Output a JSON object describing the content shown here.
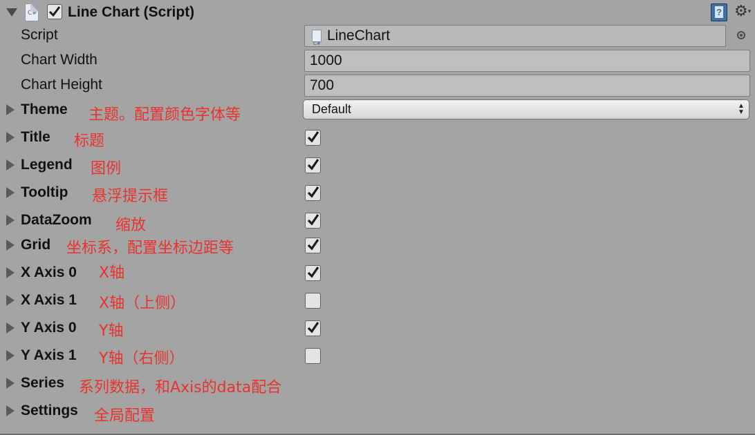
{
  "header": {
    "title": "Line Chart (Script)",
    "script_icon_text": "C#",
    "help_icon_text": "?",
    "enabled": true
  },
  "fields": {
    "script": {
      "label": "Script",
      "value": "LineChart"
    },
    "chart_width": {
      "label": "Chart Width",
      "value": "1000"
    },
    "chart_height": {
      "label": "Chart Height",
      "value": "700"
    }
  },
  "theme": {
    "label": "Theme",
    "note": "主题。配置颜色字体等",
    "selected": "Default"
  },
  "sections": [
    {
      "label": "Title",
      "note": "标题",
      "checked": true
    },
    {
      "label": "Legend",
      "note": "图例",
      "checked": true
    },
    {
      "label": "Tooltip",
      "note": "悬浮提示框",
      "checked": true
    },
    {
      "label": "DataZoom",
      "note": "缩放",
      "checked": true
    },
    {
      "label": "Grid",
      "note": "坐标系，配置坐标边距等",
      "checked": true
    },
    {
      "label": "X Axis 0",
      "note": "X轴",
      "checked": true
    },
    {
      "label": "X Axis 1",
      "note": "X轴（上侧）",
      "checked": false
    },
    {
      "label": "Y Axis 0",
      "note": "Y轴",
      "checked": true
    },
    {
      "label": "Y Axis 1",
      "note": "Y轴（右侧）",
      "checked": false
    }
  ],
  "series": {
    "label": "Series",
    "note": "系列数据，和Axis的data配合"
  },
  "settings": {
    "label": "Settings",
    "note": "全局配置"
  },
  "colors": {
    "background": "#a4a4a4",
    "annotation": "#e8322f",
    "checkbox": "#e4e4e4",
    "checkmark": "#1a1a1a"
  }
}
